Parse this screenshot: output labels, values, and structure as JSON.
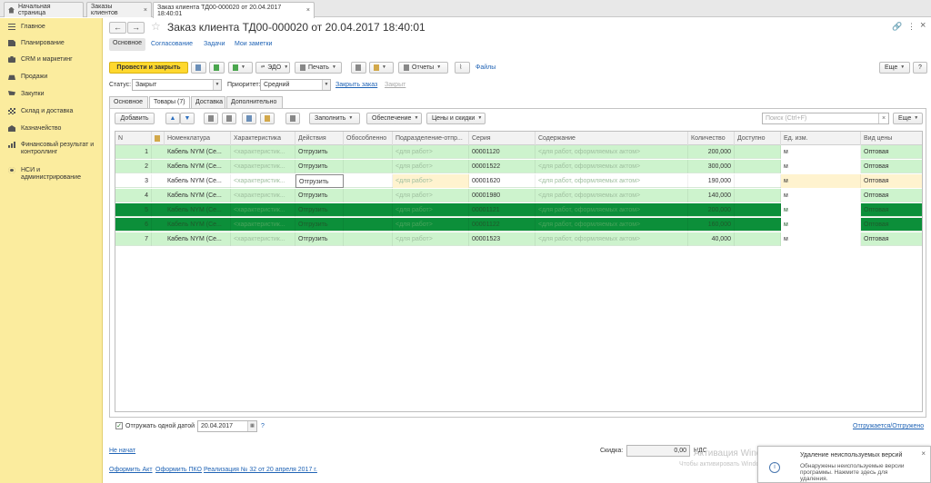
{
  "tabs": [
    {
      "label": "Начальная страница"
    },
    {
      "label": "Заказы клиентов"
    },
    {
      "label": "Заказ клиента ТД00-000020 от 20.04.2017 18:40:01"
    }
  ],
  "sidebar": {
    "items": [
      {
        "label": "Главное",
        "icon": "menu-icon"
      },
      {
        "label": "Планирование",
        "icon": "document-icon"
      },
      {
        "label": "CRM и маркетинг",
        "icon": "crm-icon"
      },
      {
        "label": "Продажи",
        "icon": "bag-icon"
      },
      {
        "label": "Закупки",
        "icon": "cart-icon"
      },
      {
        "label": "Склад и доставка",
        "icon": "warehouse-icon"
      },
      {
        "label": "Казначейство",
        "icon": "bank-icon"
      },
      {
        "label": "Финансовый результат и контроллинг",
        "icon": "chart-icon"
      },
      {
        "label": "НСИ и администрирование",
        "icon": "gear-icon"
      }
    ]
  },
  "header": {
    "title": "Заказ клиента ТД00-000020 от 20.04.2017 18:40:01",
    "back": "←",
    "forward": "→",
    "star": "☆",
    "link_icon": "🔗",
    "menu": "⋮",
    "close": "×"
  },
  "subnav": {
    "active": "Основное",
    "links": [
      "Согласование",
      "Задачи",
      "Мои заметки"
    ]
  },
  "toolbar": {
    "post_close": "Провести и закрыть",
    "edo": "ЭДО",
    "print": "Печать",
    "reports": "Отчеты",
    "files": "Файлы",
    "more": "Еще",
    "help": "?"
  },
  "status": {
    "status_label": "Статус:",
    "status_value": "Закрыт",
    "priority_label": "Приоритет:",
    "priority_value": "Средний",
    "close_order": "Закрыть заказ",
    "close": "Закрыт"
  },
  "page_tabs": [
    "Основное",
    "Товары (7)",
    "Доставка",
    "Дополнительно"
  ],
  "table_toolbar": {
    "add": "Добавить",
    "fill": "Заполнить",
    "supply": "Обеспечение",
    "prices": "Цены и скидки",
    "search_placeholder": "Поиск (Ctrl+F)",
    "more": "Еще"
  },
  "columns": [
    "N",
    "Номенклатура",
    "Характеристика",
    "Действия",
    "Обособленно",
    "Подразделение-отпр...",
    "Серия",
    "Содержание",
    "Количество",
    "Доступно",
    "Ед. изм.",
    "Вид цены"
  ],
  "rows": [
    {
      "n": "1",
      "item": "Кабель NYM (Се...",
      "char": "<характеристик...",
      "action": "Отгрузить",
      "dept": "<для работ>",
      "series": "00001120",
      "content": "<для работ, оформляемых актом>",
      "qty": "200,000",
      "unit": "м",
      "price_type": "Оптовая"
    },
    {
      "n": "2",
      "item": "Кабель NYM (Се...",
      "char": "<характеристик...",
      "action": "Отгрузить",
      "dept": "<для работ>",
      "series": "00001522",
      "content": "<для работ, оформляемых актом>",
      "qty": "300,000",
      "unit": "м",
      "price_type": "Оптовая"
    },
    {
      "n": "3",
      "item": "Кабель NYM (Се...",
      "char": "<характеристик...",
      "action": "Отгрузить",
      "dept": "<для работ>",
      "series": "00001620",
      "content": "<для работ, оформляемых актом>",
      "qty": "190,000",
      "unit": "м",
      "price_type": "Оптовая"
    },
    {
      "n": "4",
      "item": "Кабель NYM (Се...",
      "char": "<характеристик...",
      "action": "Отгрузить",
      "dept": "<для работ>",
      "series": "00001980",
      "content": "<для работ, оформляемых актом>",
      "qty": "140,000",
      "unit": "м",
      "price_type": "Оптовая"
    },
    {
      "n": "5",
      "item": "Кабель NYM (Се...",
      "char": "<характеристик...",
      "action": "Отгрузить",
      "dept": "<для работ>",
      "series": "00001121",
      "content": "<для работ, оформляемых актом>",
      "qty": "200,000",
      "unit": "м",
      "price_type": "Оптовая"
    },
    {
      "n": "6",
      "item": "Кабель NYM (Се...",
      "char": "<характеристик...",
      "action": "Отгрузить",
      "dept": "<для работ>",
      "series": "00001122",
      "content": "<для работ, оформляемых актом>",
      "qty": "160,000",
      "unit": "м",
      "price_type": "Оптовая"
    },
    {
      "n": "7",
      "item": "Кабель NYM (Се...",
      "char": "<характеристик...",
      "action": "Отгрузить",
      "dept": "<для работ>",
      "series": "00001523",
      "content": "<для работ, оформляемых актом>",
      "qty": "40,000",
      "unit": "м",
      "price_type": "Оптовая"
    }
  ],
  "bottom": {
    "ship_one_date": "Отгружать одной датой",
    "date": "20.04.2017",
    "help": "?",
    "shipped_status": "Отгружается/Отгружено",
    "not_started": "Не начат",
    "discount_label": "Скидка:",
    "discount_value": "0,00",
    "vat": "НДС",
    "links": [
      "Оформить Акт",
      "Оформить ПКО",
      "Реализация № 32 от 20 апреля 2017 г."
    ]
  },
  "watermark": {
    "line1": "Активация Windows",
    "line2": "Чтобы активировать Windows, пере"
  },
  "notification": {
    "title": "Удаление неиспользуемых версий",
    "text": "Обнаружены неиспользуемые версии программы. Нажмите здесь для удаления."
  }
}
